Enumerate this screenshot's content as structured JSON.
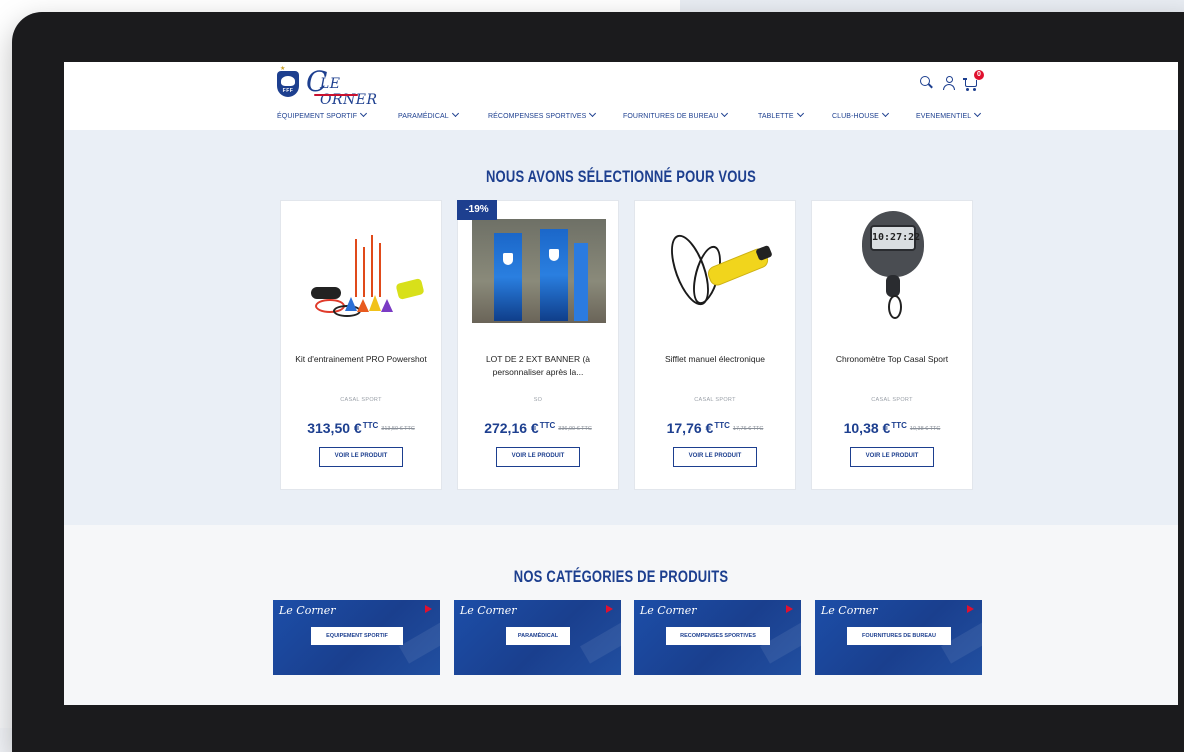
{
  "header": {
    "logo_fff_letters": "FFF",
    "logo_corner_big": "C",
    "logo_corner_small": "LE ORNER",
    "cart_count": "0"
  },
  "nav": [
    {
      "label": "Équipement sportif"
    },
    {
      "label": "Paramédical"
    },
    {
      "label": "Récompenses sportives"
    },
    {
      "label": "Fournitures de bureau"
    },
    {
      "label": "Tablette"
    },
    {
      "label": "Club-house"
    },
    {
      "label": "Evenementiel"
    }
  ],
  "selection": {
    "title": "NOUS AVONS SÉLECTIONNÉ POUR VOUS",
    "products": [
      {
        "name": "Kit d'entrainement PRO Powershot",
        "brand": "CASAL SPORT",
        "price": "313,50 €",
        "ttc": "TTC",
        "old_price": "313,50 € TTC",
        "button": "VOIR LE PRODUIT",
        "discount": ""
      },
      {
        "name": "LOT DE 2 EXT BANNER (à personnaliser après la...",
        "brand": "SO",
        "price": "272,16 €",
        "ttc": "TTC",
        "old_price": "336,00 € TTC",
        "button": "VOIR LE PRODUIT",
        "discount": "-19%"
      },
      {
        "name": "Sifflet manuel électronique",
        "brand": "CASAL SPORT",
        "price": "17,76 €",
        "ttc": "TTC",
        "old_price": "17,76 € TTC",
        "button": "VOIR LE PRODUIT",
        "discount": ""
      },
      {
        "name": "Chronomètre Top Casal Sport",
        "brand": "CASAL SPORT",
        "price": "10,38 €",
        "ttc": "TTC",
        "old_price": "10,38 € TTC",
        "button": "VOIR LE PRODUIT",
        "discount": ""
      }
    ]
  },
  "categories": {
    "title": "NOS CATÉGORIES DE PRODUITS",
    "tiles": [
      {
        "label": "EQUIPEMENT SPORTIF",
        "logo": "Le Corner"
      },
      {
        "label": "PARAMÉDICAL",
        "logo": "Le Corner"
      },
      {
        "label": "RECOMPENSES SPORTIVES",
        "logo": "Le Corner"
      },
      {
        "label": "FOURNITURES DE BUREAU",
        "logo": "Le Corner"
      }
    ]
  },
  "chrono_display": "10:27:22",
  "colors": {
    "brand_blue": "#1d3f8f",
    "accent_red": "#e0102e",
    "section_bg": "#eaeff6"
  }
}
